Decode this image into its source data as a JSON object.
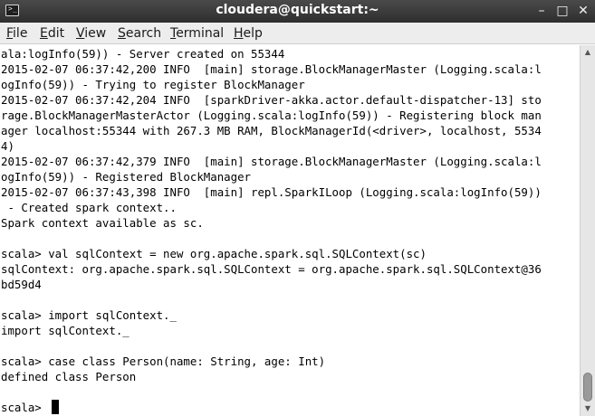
{
  "window": {
    "title": "cloudera@quickstart:~",
    "app_icon_glyph": ">_",
    "minimize_glyph": "–",
    "maximize_glyph": "□",
    "close_glyph": "✕"
  },
  "menu": {
    "items": [
      {
        "mnemonic": "F",
        "rest": "ile"
      },
      {
        "mnemonic": "E",
        "rest": "dit"
      },
      {
        "mnemonic": "V",
        "rest": "iew"
      },
      {
        "mnemonic": "S",
        "rest": "earch"
      },
      {
        "mnemonic": "T",
        "rest": "erminal"
      },
      {
        "mnemonic": "H",
        "rest": "elp"
      }
    ]
  },
  "terminal": {
    "lines": [
      "ala:logInfo(59)) - Server created on 55344",
      "2015-02-07 06:37:42,200 INFO  [main] storage.BlockManagerMaster (Logging.scala:l",
      "ogInfo(59)) - Trying to register BlockManager",
      "2015-02-07 06:37:42,204 INFO  [sparkDriver-akka.actor.default-dispatcher-13] sto",
      "rage.BlockManagerMasterActor (Logging.scala:logInfo(59)) - Registering block man",
      "ager localhost:55344 with 267.3 MB RAM, BlockManagerId(<driver>, localhost, 5534",
      "4)",
      "2015-02-07 06:37:42,379 INFO  [main] storage.BlockManagerMaster (Logging.scala:l",
      "ogInfo(59)) - Registered BlockManager",
      "2015-02-07 06:37:43,398 INFO  [main] repl.SparkILoop (Logging.scala:logInfo(59))",
      " - Created spark context..",
      "Spark context available as sc.",
      "",
      "scala> val sqlContext = new org.apache.spark.sql.SQLContext(sc)",
      "sqlContext: org.apache.spark.sql.SQLContext = org.apache.spark.sql.SQLContext@36",
      "bd59d4",
      "",
      "scala> import sqlContext._",
      "import sqlContext._",
      "",
      "scala> case class Person(name: String, age: Int)",
      "defined class Person",
      "",
      "scala> "
    ]
  },
  "scrollbar": {
    "up_glyph": "▲",
    "down_glyph": "▼"
  }
}
